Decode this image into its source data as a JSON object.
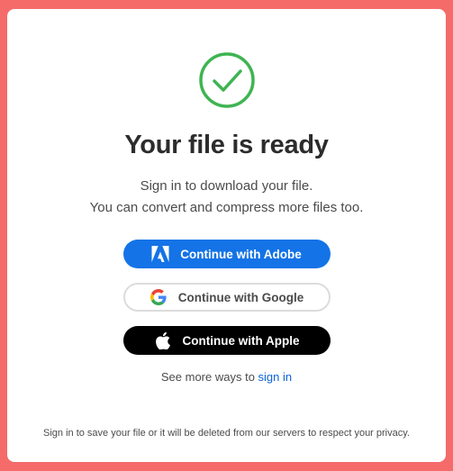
{
  "title": "Your file is ready",
  "subtitle_line1": "Sign in to download your file.",
  "subtitle_line2": "You can convert and compress more files too.",
  "buttons": {
    "adobe": "Continue with Adobe",
    "google": "Continue with Google",
    "apple": "Continue with Apple"
  },
  "more_prefix": "See more ways to ",
  "more_link": "sign in",
  "footer": "Sign in to save your file or it will be deleted from our servers to respect your privacy.",
  "icons": {
    "success": "check-circle-icon",
    "adobe": "adobe-logo-icon",
    "google": "google-logo-icon",
    "apple": "apple-logo-icon"
  },
  "colors": {
    "background": "#f46b6a",
    "success": "#3fb452",
    "adobe_button": "#1473e6",
    "apple_button": "#000000",
    "link": "#0f64d2"
  }
}
